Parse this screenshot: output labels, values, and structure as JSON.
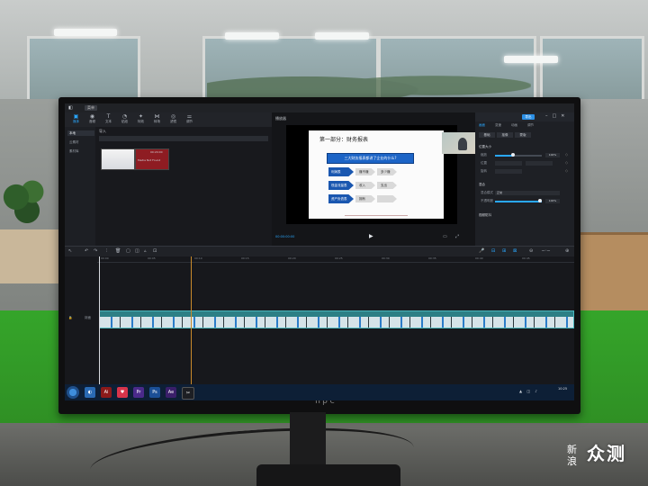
{
  "app": {
    "menu_label": "菜单",
    "doc_title": "",
    "toolbar": [
      {
        "label": "媒体",
        "icon": "media-icon",
        "active": true
      },
      {
        "label": "音频",
        "icon": "audio-icon",
        "active": false
      },
      {
        "label": "文本",
        "icon": "text-icon",
        "active": false
      },
      {
        "label": "贴纸",
        "icon": "sticker-icon",
        "active": false
      },
      {
        "label": "特效",
        "icon": "effects-icon",
        "active": false
      },
      {
        "label": "转场",
        "icon": "transition-icon",
        "active": false
      },
      {
        "label": "滤镜",
        "icon": "filter-icon",
        "active": false
      },
      {
        "label": "调节",
        "icon": "adjust-icon",
        "active": false
      }
    ],
    "sidebar": [
      {
        "label": "本地",
        "active": true
      },
      {
        "label": "云素材",
        "active": false
      },
      {
        "label": "素材库",
        "active": false
      }
    ],
    "media": {
      "header": "导入",
      "bar_text": "",
      "thumb2_text": "Media Not Found",
      "thumb2_time": "00:24:00"
    },
    "player": {
      "header": "播放器",
      "slide_title": "第一部分：财务报表",
      "slide_banner": "三大财务报表都讲了企业的什么?",
      "rows": [
        {
          "left": "利润表",
          "mid": "赚不赚",
          "right": "多少赚"
        },
        {
          "left": "现金流量表",
          "mid": "收入",
          "right": "支出"
        },
        {
          "left": "资产负债表",
          "mid": "拥有",
          "right": ""
        }
      ],
      "timecode": "00:00:00:00"
    },
    "props": {
      "export": "导出",
      "tabs": [
        "画面",
        "变速",
        "动画",
        "调节"
      ],
      "subtabs": [
        "基础",
        "抠像",
        "蒙版"
      ],
      "sections": [
        "位置大小",
        "混合",
        "视频防抖"
      ],
      "labels": [
        "缩放",
        "位置",
        "旋转",
        "混合模式",
        "不透明度"
      ],
      "scale_value": "100%",
      "blend_mode": "正常",
      "opacity_value": "100%"
    },
    "timeline": {
      "ruler_labels": [
        "00:00",
        "00:05",
        "00:10",
        "00:15",
        "00:20",
        "00:25",
        "00:30",
        "00:35",
        "00:40",
        "00:45"
      ],
      "track_label": "封面",
      "clip_name": ""
    },
    "taskbar": {
      "time": "10:25"
    }
  },
  "monitor_brand": "npc",
  "watermark": {
    "big": "众测",
    "small_top": "新",
    "small_bottom": "浪"
  }
}
